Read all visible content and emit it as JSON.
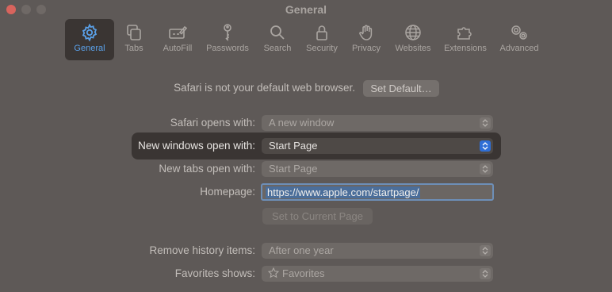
{
  "window": {
    "title": "General"
  },
  "toolbar": {
    "items": [
      {
        "label": "General",
        "icon": "gear-icon",
        "active": true
      },
      {
        "label": "Tabs",
        "icon": "tabs-icon"
      },
      {
        "label": "AutoFill",
        "icon": "autofill-pencil-icon"
      },
      {
        "label": "Passwords",
        "icon": "key-icon"
      },
      {
        "label": "Search",
        "icon": "search-icon"
      },
      {
        "label": "Security",
        "icon": "lock-icon"
      },
      {
        "label": "Privacy",
        "icon": "hand-icon"
      },
      {
        "label": "Websites",
        "icon": "globe-icon"
      },
      {
        "label": "Extensions",
        "icon": "puzzle-icon"
      },
      {
        "label": "Advanced",
        "icon": "gears-icon"
      }
    ]
  },
  "default_browser": {
    "message": "Safari is not your default web browser.",
    "button": "Set Default…"
  },
  "settings": {
    "opens_with": {
      "label": "Safari opens with:",
      "value": "A new window"
    },
    "new_windows": {
      "label": "New windows open with:",
      "value": "Start Page"
    },
    "new_tabs": {
      "label": "New tabs open with:",
      "value": "Start Page"
    },
    "homepage": {
      "label": "Homepage:",
      "value": "https://www.apple.com/startpage/",
      "button": "Set to Current Page"
    },
    "remove_history": {
      "label": "Remove history items:",
      "value": "After one year"
    },
    "favorites": {
      "label": "Favorites shows:",
      "value": "Favorites"
    }
  },
  "colors": {
    "accent": "#2f6fd6",
    "active_label": "#5aa0e8",
    "background": "#5e5957",
    "highlight": "#3a3533"
  }
}
